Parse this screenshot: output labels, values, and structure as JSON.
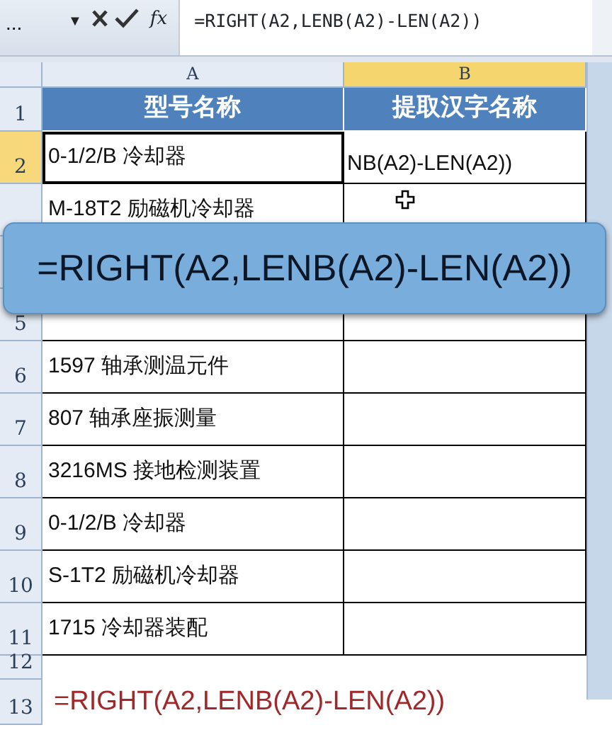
{
  "formula_bar": {
    "name_box": "...",
    "dropdown": "▼",
    "fx": "fx",
    "formula": "=RIGHT(A2,LENB(A2)-LEN(A2))"
  },
  "columns": [
    {
      "label": "A",
      "selected": false
    },
    {
      "label": "B",
      "selected": true
    }
  ],
  "rows": [
    {
      "number": "1",
      "selected": false,
      "kind": "header",
      "cells": [
        "型号名称",
        "提取汉字名称"
      ]
    },
    {
      "number": "2",
      "selected": true,
      "kind": "data",
      "active": true,
      "cells": [
        "0-1/2/B 冷却器",
        "NB(A2)-LEN(A2))"
      ]
    },
    {
      "kind": "data",
      "cells": [
        "M-18T2 励磁机冷却器"
      ]
    },
    {
      "kind": "data"
    },
    {
      "number": "5",
      "kind": "data",
      "selected": false
    },
    {
      "number": "6",
      "kind": "data",
      "selected": false,
      "cells": [
        "1597 轴承测温元件"
      ]
    },
    {
      "number": "7",
      "kind": "data",
      "selected": false,
      "cells": [
        "807 轴承座振测量"
      ]
    },
    {
      "number": "8",
      "kind": "data",
      "selected": false,
      "cells": [
        "3216MS 接地检测装置"
      ]
    },
    {
      "number": "9",
      "kind": "data",
      "selected": false,
      "cells": [
        "0-1/2/B 冷却器"
      ]
    },
    {
      "number": "10",
      "kind": "data",
      "selected": false,
      "cells": [
        "S-1T2 励磁机冷却器"
      ]
    },
    {
      "number": "11",
      "kind": "data",
      "selected": false,
      "cells": [
        "1715 冷却器装配"
      ]
    },
    {
      "number": "12",
      "kind": "blank",
      "selected": false
    },
    {
      "number": "13",
      "kind": "note",
      "selected": false,
      "cells": [
        "=RIGHT(A2,LENB(A2)-LEN(A2))"
      ]
    }
  ],
  "callout": {
    "text": "=RIGHT(A2,LENB(A2)-LEN(A2))"
  }
}
